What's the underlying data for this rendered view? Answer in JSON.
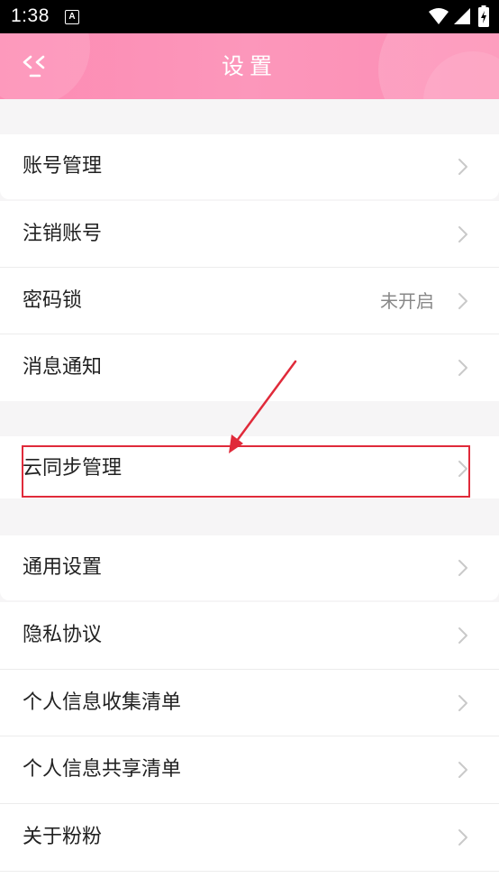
{
  "status_bar": {
    "time": "1:38",
    "notification_glyph": "A",
    "icons": [
      "wifi-icon",
      "signal-icon",
      "battery-charging-icon"
    ]
  },
  "header": {
    "title": "设置",
    "back_icon": "double-chevron-left-icon"
  },
  "groups": [
    {
      "items": [
        {
          "label": "账号管理",
          "value": "",
          "icon": "chevron-right-icon"
        }
      ]
    },
    {
      "items": [
        {
          "label": "注销账号",
          "value": "",
          "icon": "chevron-right-icon"
        },
        {
          "label": "密码锁",
          "value": "未开启",
          "icon": "chevron-right-icon"
        },
        {
          "label": "消息通知",
          "value": "",
          "icon": "chevron-right-icon"
        }
      ]
    },
    {
      "items": [
        {
          "label": "云同步管理",
          "value": "",
          "icon": "chevron-right-icon"
        }
      ]
    },
    {
      "items": [
        {
          "label": "通用设置",
          "value": "",
          "icon": "chevron-right-icon"
        }
      ]
    },
    {
      "items": [
        {
          "label": "隐私协议",
          "value": "",
          "icon": "chevron-right-icon"
        },
        {
          "label": "个人信息收集清单",
          "value": "",
          "icon": "chevron-right-icon"
        },
        {
          "label": "个人信息共享清单",
          "value": "",
          "icon": "chevron-right-icon"
        },
        {
          "label": "关于粉粉",
          "value": "",
          "icon": "chevron-right-icon"
        }
      ]
    }
  ],
  "colors": {
    "header_gradient": [
      "#fd8bb3",
      "#fc97bb"
    ],
    "annotation": "#e02a3a",
    "page_background": "#f6f5f6"
  }
}
